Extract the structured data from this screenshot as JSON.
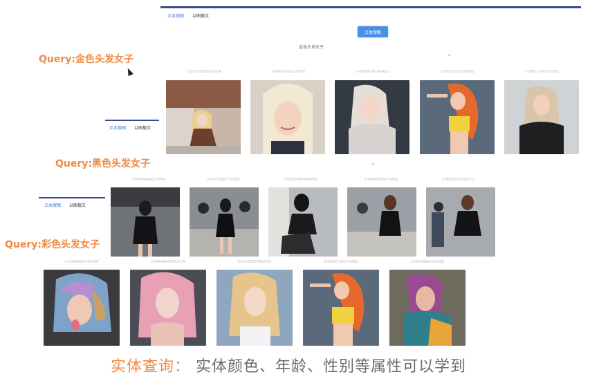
{
  "panel1": {
    "tabs": [
      "文本搜图",
      "以图搜文"
    ],
    "search_button": "文本搜图",
    "query_text": "金色头发女子",
    "image_ids": [
      "0.9712393366381414",
      "0.4994375151117096",
      "0.4996871407454923",
      "0.9323231507230892",
      "0.3600177497133922"
    ]
  },
  "panel2": {
    "tabs": [
      "文本搜图",
      "以图搜文"
    ],
    "image_ids": [
      "0.4994340482274954",
      "0.4710148077599411",
      "0.4601148666688966",
      "0.4429488596774626",
      "0.4600320153921711"
    ]
  },
  "panel3": {
    "tabs": [
      "文本搜图",
      "以图搜文"
    ],
    "image_ids": [
      "0.4366686347491008",
      "0.4499986456014779",
      "0.4379223696633002",
      "0.4339873997714993",
      "0.4363689414971938"
    ]
  },
  "labels": {
    "query1": "Query:金色头发女子",
    "query2": "Query:黑色头发女子",
    "query3": "Query:彩色头发女子"
  },
  "caption": {
    "highlight": "实体查询",
    "sep": "：",
    "rest": "实体颜色、年龄、性别等属性可以学到"
  }
}
